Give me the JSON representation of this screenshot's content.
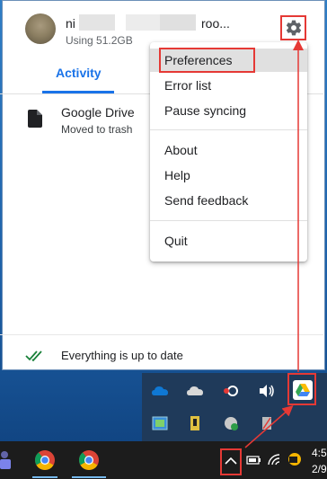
{
  "account": {
    "name_visible_prefix": "ni",
    "name_visible_suffix": "roo...",
    "usage": "Using 51.2GB"
  },
  "tabs": [
    {
      "label": "Activity",
      "active": true
    }
  ],
  "activity": [
    {
      "title": "Google Drive",
      "subtitle": "Moved to trash",
      "icon": "file-icon"
    }
  ],
  "status": {
    "text": "Everything is up to date",
    "icon": "double-check-icon"
  },
  "menu": {
    "groups": [
      [
        "Preferences",
        "Error list",
        "Pause syncing"
      ],
      [
        "About",
        "Help",
        "Send feedback"
      ],
      [
        "Quit"
      ]
    ],
    "highlighted": "Preferences"
  },
  "clock": {
    "time": "4:5",
    "date": "2/9"
  },
  "colors": {
    "accent": "#1a73e8",
    "highlight_box": "#e53935",
    "taskbar": "#1c1c1c"
  }
}
